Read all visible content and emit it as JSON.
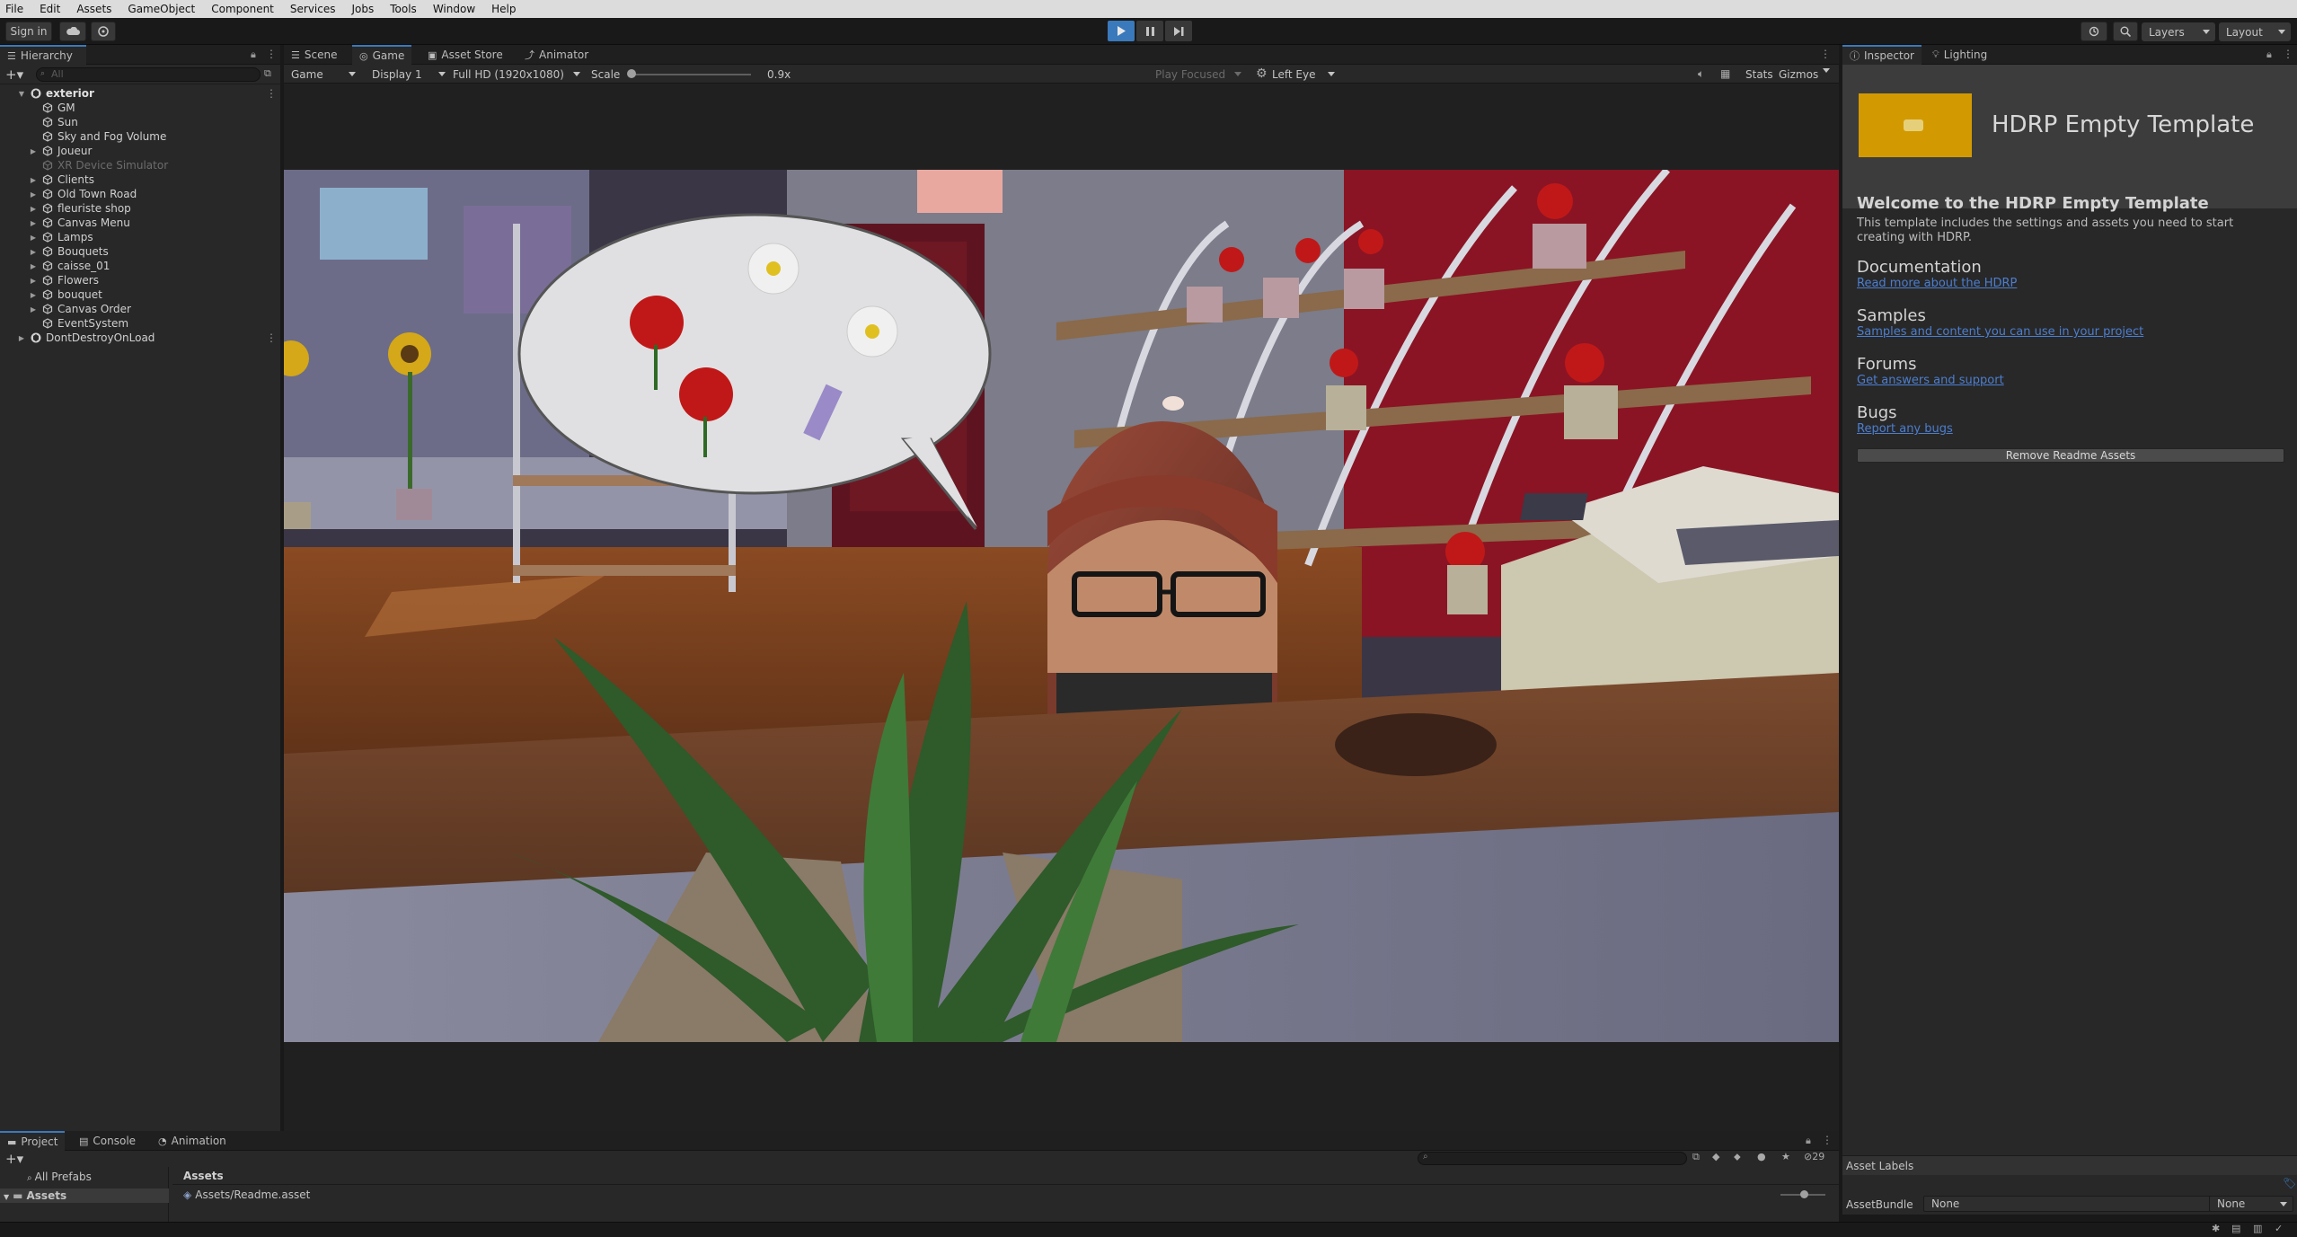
{
  "menu": [
    "File",
    "Edit",
    "Assets",
    "GameObject",
    "Component",
    "Services",
    "Jobs",
    "Tools",
    "Window",
    "Help"
  ],
  "toolbar": {
    "sign_in": "Sign in",
    "layers": "Layers",
    "layout": "Layout"
  },
  "hierarchy": {
    "tab": "Hierarchy",
    "search_placeholder": "All",
    "scene": "exterior",
    "items": [
      "GM",
      "Sun",
      "Sky and Fog Volume",
      "Joueur",
      "XR Device Simulator",
      "Clients",
      "Old Town Road",
      "fleuriste shop",
      "Canvas Menu",
      "Lamps",
      "Bouquets",
      "caisse_01",
      "Flowers",
      "bouquet",
      "Canvas Order",
      "EventSystem"
    ],
    "dont_destroy": "DontDestroyOnLoad"
  },
  "center_tabs": [
    "Scene",
    "Game",
    "Asset Store",
    "Animator"
  ],
  "game_bar": {
    "mode": "Game",
    "display": "Display 1",
    "resolution": "Full HD (1920x1080)",
    "scale_label": "Scale",
    "scale_value": "0.9x",
    "play_focused": "Play Focused",
    "eye": "Left Eye",
    "stats": "Stats",
    "gizmos": "Gizmos"
  },
  "inspector": {
    "tabs": [
      "Inspector",
      "Lighting"
    ],
    "title": "HDRP Empty Template",
    "welcome_title": "Welcome to the HDRP Empty Template",
    "welcome_text": "This template includes the settings and assets you need to start creating with HDRP.",
    "sections": [
      {
        "heading": "Documentation",
        "link": "Read more about the HDRP"
      },
      {
        "heading": "Samples",
        "link": "Samples and content you can use in your project"
      },
      {
        "heading": "Forums",
        "link": "Get answers and support"
      },
      {
        "heading": "Bugs",
        "link": "Report any bugs"
      }
    ],
    "remove_button": "Remove Readme Assets",
    "asset_labels": "Asset Labels",
    "asset_bundle_label": "AssetBundle",
    "asset_bundle_value": "None",
    "asset_bundle_variant": "None"
  },
  "bottom": {
    "tabs": [
      "Project",
      "Console",
      "Animation"
    ],
    "all_prefabs": "All Prefabs",
    "assets_folder": "Assets",
    "breadcrumb": "Assets",
    "file": "Assets/Readme.asset",
    "hidden_count": "29"
  },
  "colors": {
    "accent": "#3a79bb",
    "template_icon": "#d29a00",
    "link": "#4c7ecf",
    "menubar": "#dcdcdc"
  }
}
